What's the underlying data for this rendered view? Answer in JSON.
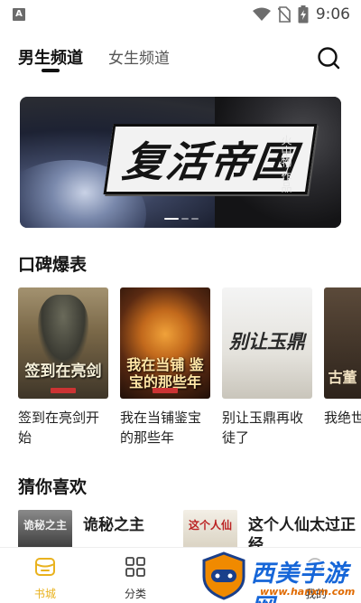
{
  "status_bar": {
    "time": "9:06",
    "app_icon_letter": "A"
  },
  "tabs": {
    "male": "男生频道",
    "female": "女生频道"
  },
  "banner": {
    "title": "复活帝国",
    "author": "火中物 作品"
  },
  "sections": {
    "word_of_mouth": "口碑爆表",
    "guess_you_like": "猜你喜欢"
  },
  "books": [
    {
      "title": "签到在亮剑开始",
      "cover_text": "签到在亮剑"
    },
    {
      "title": "我在当铺鉴宝的那些年",
      "cover_text": "我在当铺 鉴宝的那些年"
    },
    {
      "title": "别让玉鼎再收徒了",
      "cover_text": "别让玉鼎"
    },
    {
      "title": "我绝世神秘",
      "cover_text": "古董"
    }
  ],
  "recommendations": [
    {
      "title": "诡秘之主",
      "cover_text": "诡秘之主"
    },
    {
      "title": "这个人仙太过正经",
      "cover_text": "这个人仙"
    }
  ],
  "bottom_nav": {
    "bookstore": "书城",
    "category": "分类",
    "mine": "我的"
  },
  "watermark": {
    "name": "西美手游网",
    "url": "www.hanxm.com"
  },
  "colors": {
    "accent": "#e9b21e",
    "watermark_blue": "#1666d8",
    "watermark_orange": "#e06a00"
  }
}
